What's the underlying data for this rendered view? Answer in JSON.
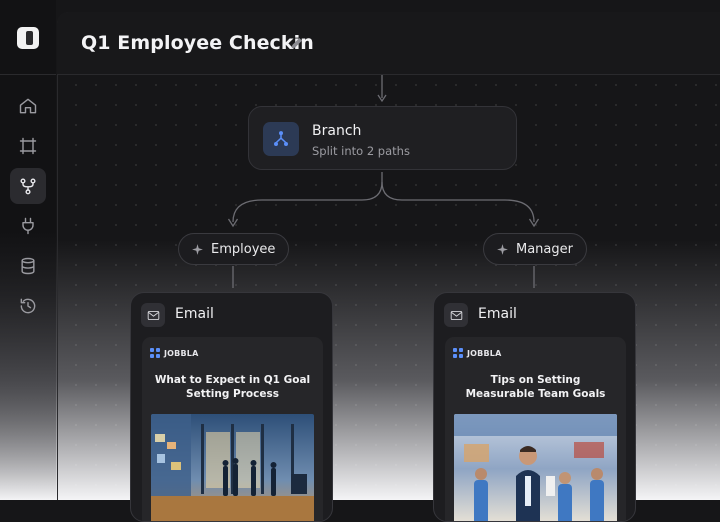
{
  "workflow": {
    "title": "Q1 Employee Checkin"
  },
  "sidebar": {
    "items": [
      {
        "name": "home",
        "icon": "home-icon",
        "active": false
      },
      {
        "name": "frame",
        "icon": "frame-icon",
        "active": false
      },
      {
        "name": "workflows",
        "icon": "branch-icon",
        "active": true
      },
      {
        "name": "integrations",
        "icon": "plug-icon",
        "active": false
      },
      {
        "name": "data",
        "icon": "database-icon",
        "active": false
      },
      {
        "name": "history",
        "icon": "history-icon",
        "active": false
      }
    ]
  },
  "branch_node": {
    "title": "Branch",
    "subtitle": "Split into 2 paths",
    "icon": "branch-icon"
  },
  "paths": [
    {
      "label": "Employee",
      "icon": "sparkle-icon",
      "email": {
        "label": "Email",
        "brand": "JOBBLA",
        "headline": "What to Expect in Q1 Goal Setting Process"
      }
    },
    {
      "label": "Manager",
      "icon": "sparkle-icon",
      "email": {
        "label": "Email",
        "brand": "JOBBLA",
        "headline": "Tips on Setting Measurable Team Goals"
      }
    }
  ],
  "colors": {
    "background": "#161618",
    "node": "#1f1f22",
    "branch_icon_bg": "#2c3a55",
    "accent_blue": "#4f86f7"
  }
}
